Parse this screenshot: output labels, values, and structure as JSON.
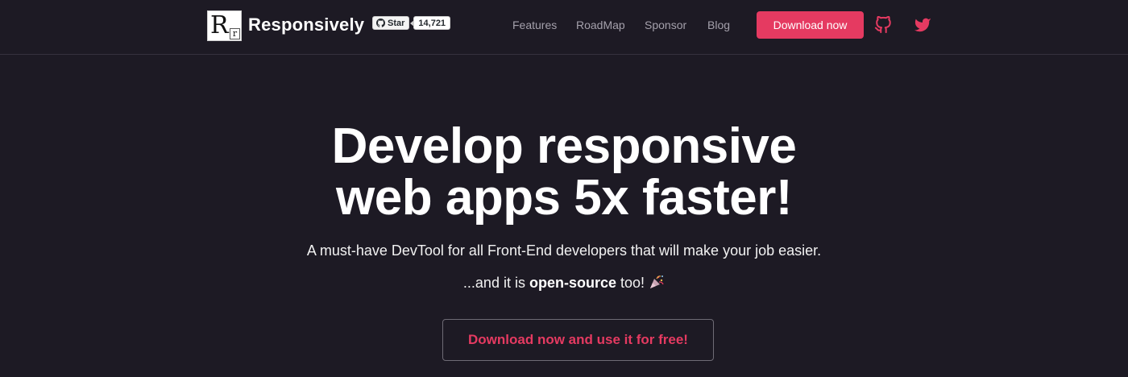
{
  "header": {
    "logo": {
      "big_letter": "R",
      "small_letter": "r"
    },
    "brand": "Responsively",
    "github_badge": {
      "star_label": "Star",
      "count": "14,721",
      "icon": "github-icon"
    },
    "nav": [
      {
        "label": "Features"
      },
      {
        "label": "RoadMap"
      },
      {
        "label": "Sponsor"
      },
      {
        "label": "Blog"
      }
    ],
    "download_label": "Download now",
    "social_icons": [
      "github-icon",
      "twitter-icon"
    ]
  },
  "hero": {
    "title_line1": "Develop responsive",
    "title_line2": "web apps 5x faster!",
    "subtitle": "A must-have DevTool for all Front-End developers that will make your job easier.",
    "oss_prefix": "...and it is",
    "oss_bold": "open-source",
    "oss_suffix": "too!",
    "oss_emoji": "party-popper-icon",
    "cta_label": "Download now and use it for free!"
  },
  "colors": {
    "background": "#1d1a24",
    "accent": "#e53a61",
    "nav_text": "#a4a0ab"
  }
}
